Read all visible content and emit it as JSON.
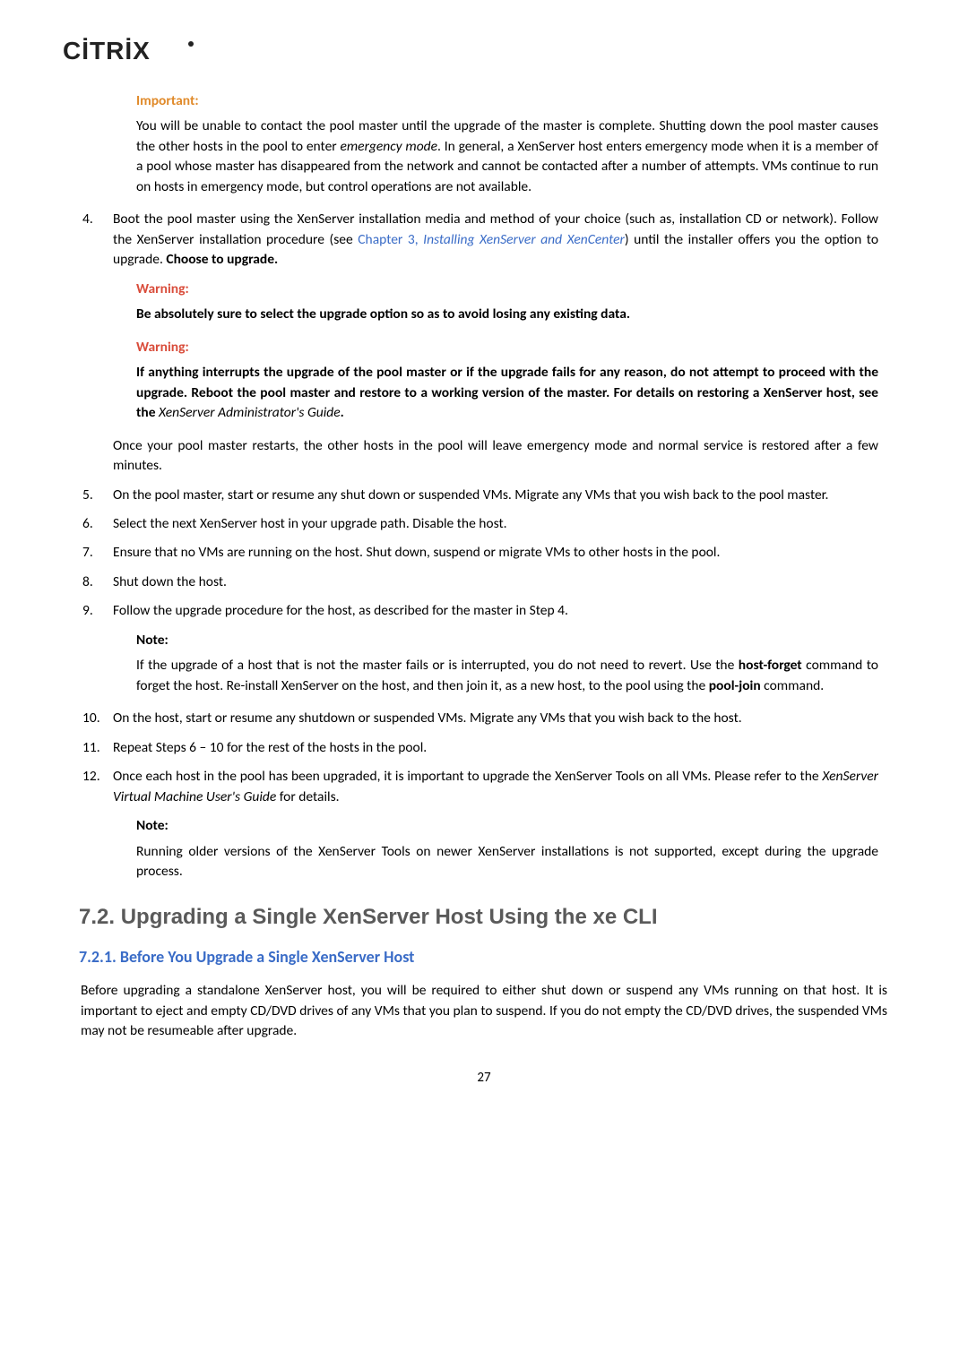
{
  "logo_brand": "CITRIX",
  "important": {
    "label": "Important:",
    "body": "You will be unable to contact the pool master until the upgrade of the master is complete. Shutting down the pool master causes the other hosts in the pool to enter emergency mode. In general, a XenServer host enters emergency mode when it is a member of a pool whose master has disappeared from the network and cannot be contacted after a number of attempts. VMs continue to run on hosts in emergency mode, but control operations are not available."
  },
  "step4": {
    "num": "4.",
    "text_a": "Boot the pool master using the XenServer installation media and method of your choice (such as, installation CD or network). Follow the XenServer installation procedure (see ",
    "link_a": "Chapter 3, ",
    "link_b": "Installing XenServer and XenCenter",
    "text_b": ") until the installer offers you the option to upgrade. ",
    "bold_tail": "Choose to upgrade."
  },
  "warning1": {
    "label": "Warning:",
    "body": "Be absolutely sure to select the upgrade option so as to avoid losing any existing data."
  },
  "warning2": {
    "label": "Warning:",
    "body_a": "If anything interrupts the upgrade of the pool master or if the upgrade fails for any reason, do not attempt to proceed with the upgrade. Reboot the pool master and restore to a working version of the master. For details on restoring a XenServer host, see the ",
    "italic": "XenServer Administrator's Guide",
    "period": "."
  },
  "step4_post": "Once your pool master restarts, the other hosts in the pool will leave emergency mode and normal service is restored after a few minutes.",
  "step5": {
    "num": "5.",
    "body": "On the pool master, start or resume any shut down or suspended VMs. Migrate any VMs that you wish back to the pool master."
  },
  "step6": {
    "num": "6.",
    "body": "Select the next XenServer host in your upgrade path. Disable the host."
  },
  "step7": {
    "num": "7.",
    "body": "Ensure that no VMs are running on the host. Shut down, suspend or migrate VMs to other hosts in the pool."
  },
  "step8": {
    "num": "8.",
    "body": "Shut down the host."
  },
  "step9": {
    "num": "9.",
    "body": "Follow the upgrade procedure for the host, as described for the master in Step 4."
  },
  "note1": {
    "label": "Note:",
    "body_a": "If the upgrade of a host that is not the master fails or is interrupted, you do not need to revert. Use the ",
    "bold1": "host-forget",
    "body_b": " command to forget the host. Re-install XenServer on the host, and then join it, as a new host, to the pool using the ",
    "bold2": "pool-join",
    "body_c": " command."
  },
  "step10": {
    "num": "10.",
    "body": "On the host, start or resume any shutdown or suspended VMs. Migrate any VMs that you wish back to the host."
  },
  "step11": {
    "num": "11.",
    "body": "Repeat Steps 6 – 10 for the rest of the hosts in the pool."
  },
  "step12": {
    "num": "12.",
    "body_a": "Once each host in the pool has been upgraded, it is important to upgrade the XenServer Tools on all VMs. Please refer to the ",
    "italic": "XenServer Virtual Machine User's Guide",
    "body_b": " for details."
  },
  "note2": {
    "label": "Note:",
    "body": "Running older versions of the XenServer Tools on newer XenServer installations is not supported, except during the upgrade process."
  },
  "section": {
    "h2": "7.2. Upgrading a Single XenServer Host Using the xe CLI",
    "h3": "7.2.1. Before You Upgrade a Single XenServer Host",
    "body": "Before upgrading a standalone XenServer host, you will be required to either shut down or suspend any VMs running on that host. It is important to eject and empty CD/DVD drives of any VMs that you plan to suspend. If you do not empty the CD/DVD drives, the suspended VMs may not be resumeable after upgrade."
  },
  "pagenum": "27"
}
